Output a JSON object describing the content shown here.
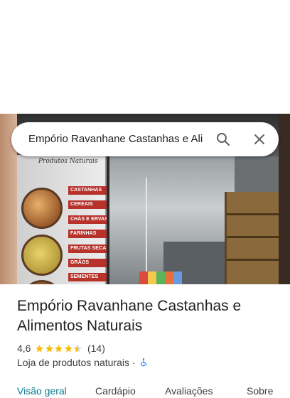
{
  "search": {
    "query": "Empório Ravanhane Castanhas e Ali"
  },
  "photo": {
    "banner_title": "Produtos Naturais",
    "tags": [
      "CASTANHAS",
      "CEREAIS",
      "CHÁS E ERVAS",
      "FARINHAS",
      "FRUTAS SECAS",
      "GRÃOS",
      "SEMENTES"
    ]
  },
  "place": {
    "name": "Empório Ravanhane Castanhas e Alimentos Naturais",
    "rating": "4,6",
    "stars": 4.6,
    "reviews": "(14)",
    "category": "Loja de produtos naturais",
    "separator": "·",
    "accessibility_icon": "wheelchair-icon"
  },
  "tabs": [
    {
      "label": "Visão geral",
      "active": true
    },
    {
      "label": "Cardápio",
      "active": false
    },
    {
      "label": "Avaliações",
      "active": false
    },
    {
      "label": "Sobre",
      "active": false
    }
  ],
  "colors": {
    "star": "#fbbc04",
    "active_tab": "#0b7a8c",
    "accessibility": "#1a73e8"
  }
}
